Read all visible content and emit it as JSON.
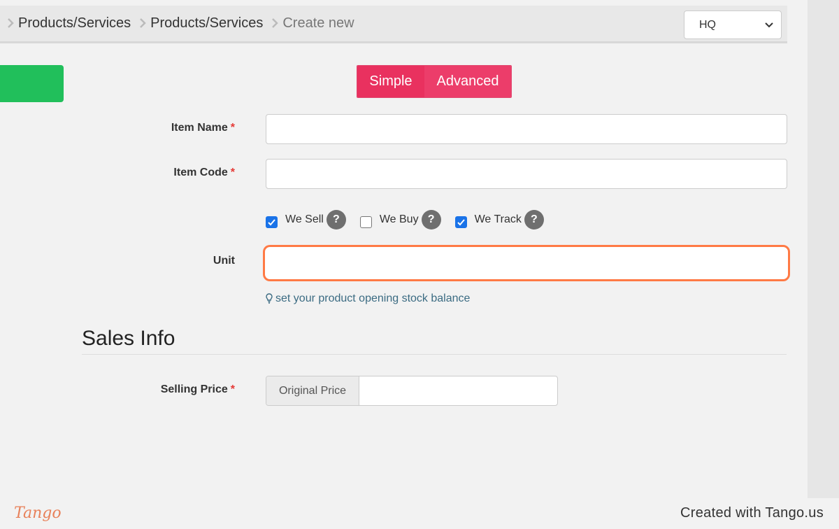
{
  "breadcrumb": {
    "items": [
      "Products/Services",
      "Products/Services",
      "Create new"
    ]
  },
  "branch_select": {
    "value": "HQ"
  },
  "mode_toggle": {
    "simple_label": "Simple",
    "advanced_label": "Advanced"
  },
  "form": {
    "item_name_label": "Item Name",
    "item_code_label": "Item Code",
    "required_marker": "*",
    "unit_label": "Unit",
    "checkboxes": [
      {
        "label": "We Sell",
        "checked": true
      },
      {
        "label": "We Buy",
        "checked": false
      },
      {
        "label": "We Track",
        "checked": true
      }
    ],
    "help_marker": "?",
    "stock_link": "set your product opening stock balance"
  },
  "sales_info": {
    "title": "Sales Info",
    "selling_price_label": "Selling Price",
    "original_price_addon": "Original Price"
  },
  "footer": {
    "credit": "Created with Tango.us",
    "logo_text": "Tango"
  },
  "colors": {
    "accent_pink": "#e9315f",
    "green": "#21bf5b",
    "highlight_orange": "#ff7a45",
    "checkbox_blue": "#1a73e8",
    "link": "#3b6b82"
  }
}
